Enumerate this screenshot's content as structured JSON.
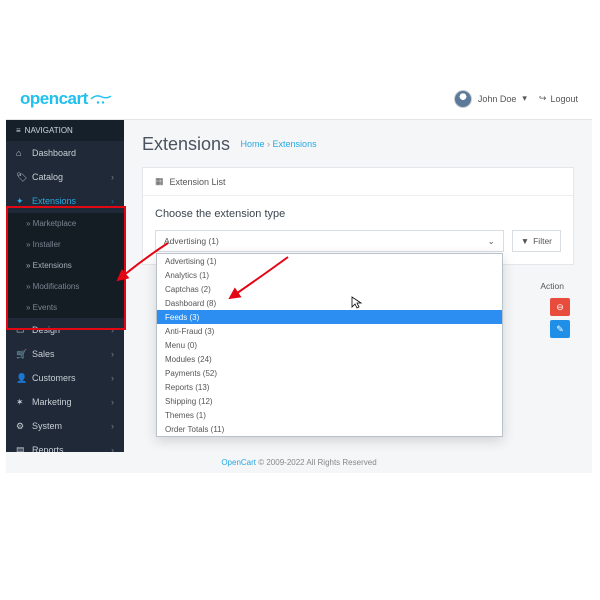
{
  "logo_text": "opencart",
  "user": {
    "name": "John Doe",
    "logout": "Logout"
  },
  "sidebar": {
    "title": "NAVIGATION",
    "items": [
      {
        "label": "Dashboard"
      },
      {
        "label": "Catalog"
      },
      {
        "label": "Extensions"
      },
      {
        "label": "Design"
      },
      {
        "label": "Sales"
      },
      {
        "label": "Customers"
      },
      {
        "label": "Marketing"
      },
      {
        "label": "System"
      },
      {
        "label": "Reports"
      }
    ],
    "sub": [
      {
        "label": "Marketplace"
      },
      {
        "label": "Installer"
      },
      {
        "label": "Extensions"
      },
      {
        "label": "Modifications"
      },
      {
        "label": "Events"
      }
    ]
  },
  "page": {
    "title": "Extensions",
    "crumb_home": "Home",
    "crumb_current": "Extensions",
    "panel_title": "Extension List",
    "subtitle": "Choose the extension type",
    "filter_btn": "Filter",
    "selected": "Advertising (1)",
    "options": [
      "Advertising (1)",
      "Analytics (1)",
      "Captchas (2)",
      "Dashboard (8)",
      "Feeds (3)",
      "Anti-Fraud (3)",
      "Menu (0)",
      "Modules (24)",
      "Payments (52)",
      "Reports (13)",
      "Shipping (12)",
      "Themes (1)",
      "Order Totals (11)"
    ],
    "action": "Action"
  },
  "footer": {
    "brand": "OpenCart",
    "rest": " © 2009-2022 All Rights Reserved"
  }
}
